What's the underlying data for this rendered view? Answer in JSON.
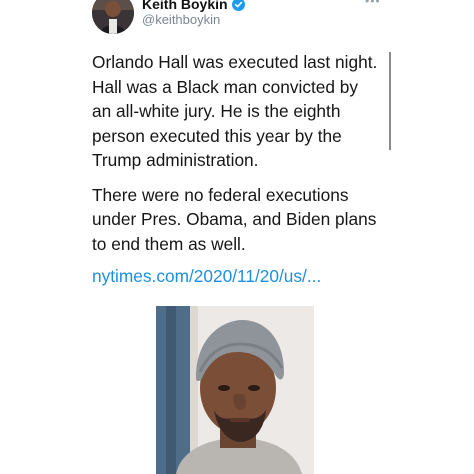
{
  "tweet": {
    "author": {
      "name": "Keith Boykin",
      "handle": "@keithboykin",
      "verified_color": "#1d9bf0"
    },
    "menu_icon": "more-horizontal-icon",
    "paragraphs": [
      "Orlando Hall was executed last night. Hall was a Black man convicted by an all-white jury. He is the eighth person executed this year by the Trump administration.",
      "There were no federal executions under Pres. Obama, and Biden plans to end them as well."
    ],
    "link": "nytimes.com/2020/11/20/us/...",
    "link_color": "#1d8fe0"
  }
}
